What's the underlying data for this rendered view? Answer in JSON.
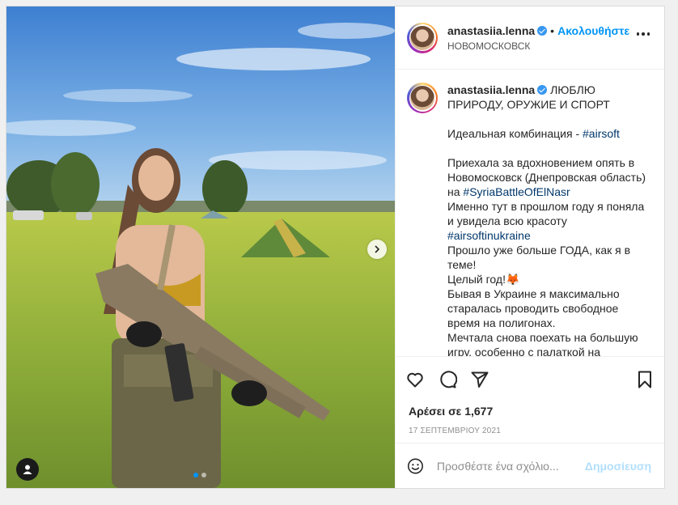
{
  "post": {
    "username": "anastasiia.lenna",
    "follow_label": "Ακολουθήστε",
    "separator": "•",
    "location": "НОВОМОСКОВСК",
    "caption": {
      "line1": "ЛЮБЛЮ ПРИРОДУ, ОРУЖИЕ И СПОРТ",
      "combo_text": "Идеальная комбинация - ",
      "tag_airsoft": "#airsoft",
      "p2_text": "Приехала за вдохновением опять в Новомосковск (Днепровская область) на ",
      "tag_syria": "#SyriaBattleOfElNasr",
      "p3_text": "Именно тут в прошлом году я поняла и увидела всю красоту ",
      "tag_ukraine": "#airsoftinukraine",
      "p4_text": "Прошло уже больше ГОДА, как я в теме!",
      "p5_text": "Целый год!",
      "p5_emoji": "🦊",
      "p6_text": "Бывая в Украине я максимально старалась проводить свободное время на полигонах.",
      "p7_text": "Мечтала снова поехать на большую игру, особенно с палаткой на несколько дней."
    },
    "likes_label": "Αρέσει σε ",
    "likes_count": "1,677",
    "date": "17 ΣΕΠΤΕΜΒΡΙΟΥ 2021",
    "comment_placeholder": "Προσθέστε ένα σχόλιο...",
    "post_button": "Δημοσίευση",
    "carousel": {
      "total": 2,
      "active_index": 0
    },
    "icons": {
      "like": "heart-icon",
      "comment": "comment-icon",
      "share": "send-icon",
      "save": "bookmark-icon",
      "emoji": "smiley-icon",
      "more": "more-icon",
      "next": "chevron-right-icon",
      "user_tags": "user-icon"
    },
    "colors": {
      "accent": "#0095f6",
      "link": "#00376b",
      "verified": "#3897f0",
      "post_disabled": "#b2dffc"
    }
  }
}
